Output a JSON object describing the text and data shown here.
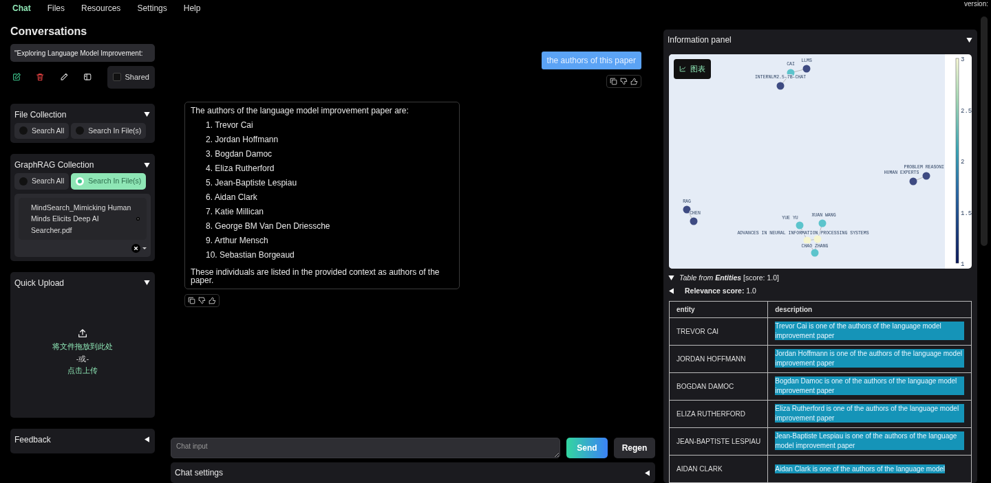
{
  "nav": {
    "tabs": [
      {
        "label": "Chat",
        "selected": true
      },
      {
        "label": "Files",
        "selected": false
      },
      {
        "label": "Resources",
        "selected": false
      },
      {
        "label": "Settings",
        "selected": false
      },
      {
        "label": "Help",
        "selected": false
      }
    ],
    "version": "version:"
  },
  "sidebar": {
    "title": "Conversations",
    "conversation": {
      "value": "\"Exploring Language Model Improvement:"
    },
    "shared": {
      "label": "Shared",
      "checked": false
    },
    "panels": [
      {
        "kind": "radio",
        "title": "File Collection",
        "expanded": true,
        "options": [
          {
            "label": "Search All",
            "selected": false
          },
          {
            "label": "Search In File(s)",
            "selected": false
          }
        ]
      },
      {
        "kind": "radio",
        "title": "GraphRAG Collection",
        "expanded": true,
        "options": [
          {
            "label": "Search All",
            "selected": false
          },
          {
            "label": "Search In File(s)",
            "selected": true
          }
        ],
        "files": [
          {
            "name": "MindSearch_Mimicking Human Minds Elicits Deep AI Searcher.pdf"
          }
        ]
      },
      {
        "kind": "upload",
        "title": "Quick Upload",
        "expanded": true,
        "lines": [
          "将文件拖放到此处",
          "-或-",
          "点击上传"
        ]
      },
      {
        "kind": "collapsed",
        "title": "Feedback",
        "expanded": false
      }
    ]
  },
  "chat": {
    "messages": [
      {
        "kind": "user",
        "text": "the authors of this paper"
      },
      {
        "kind": "assistant",
        "intro": "The authors of the language model improvement paper are:",
        "items": [
          "1. Trevor Cai",
          "2. Jordan Hoffmann",
          "3. Bogdan Damoc",
          "4. Eliza Rutherford",
          "5. Jean-Baptiste Lespiau",
          "6. Aidan Clark",
          "7. Katie Millican",
          "8. George BM Van Den Driessche",
          "9. Arthur Mensch",
          "10. Sebastian Borgeaud"
        ],
        "outro": "These individuals are listed in the provided context as authors of the paper."
      }
    ],
    "input": {
      "placeholder": "Chat input"
    },
    "buttons": [
      {
        "kind": "primary",
        "label": "Send"
      },
      {
        "kind": "secondary",
        "label": "Regen"
      }
    ],
    "settings": {
      "title": "Chat settings",
      "expanded": false
    }
  },
  "info_panel": {
    "title": "Information panel",
    "expanded": true,
    "graph": {
      "toolbar_label": "图表",
      "colorbar_ticks": [
        "3",
        "2.5",
        "2",
        "1.5",
        "1"
      ],
      "nodes": [
        {
          "label": "CAI",
          "color": "#5cc4cc"
        },
        {
          "label": "LLMS",
          "color": "#3e4b82"
        },
        {
          "label": "INTERNLM2.5-7B-CHAT",
          "color": "#3e4b82"
        },
        {
          "label": "PROBLEM REASONI",
          "color": "#3e4b82"
        },
        {
          "label": "HUMAN EXPERTS",
          "color": "#3e4b82"
        },
        {
          "label": "RAG",
          "color": "#3e4b82"
        },
        {
          "label": "CHEN",
          "color": "#3e4b82"
        },
        {
          "label": "YUE YU",
          "color": "#5cc4cc"
        },
        {
          "label": "XUAN WANG",
          "color": "#5cc4cc"
        },
        {
          "label": "ADVANCES IN NEURAL INFORMATION PROCESSING SYSTEMS",
          "color": "#f6f6cf"
        },
        {
          "color": "#f6f6cf"
        },
        {
          "label": "CHAO ZHANG",
          "color": "#5cc4cc"
        }
      ]
    },
    "caption": {
      "italic": "Table from",
      "bold_italic": "Entities",
      "rest": "[score: 1.0]",
      "expanded": true
    },
    "relevance": {
      "label": "Relevance score:",
      "value": "1.0",
      "expanded": false
    },
    "table": {
      "columns": [
        "entity",
        "description"
      ],
      "rows": [
        [
          "TREVOR CAI",
          "Trevor Cai is one of the authors of the language model improvement paper"
        ],
        [
          "JORDAN HOFFMANN",
          "Jordan Hoffmann is one of the authors of the language model improvement paper"
        ],
        [
          "BOGDAN DAMOC",
          "Bogdan Damoc is one of the authors of the language model improvement paper"
        ],
        [
          "ELIZA RUTHERFORD",
          "Eliza Rutherford is one of the authors of the language model improvement paper"
        ],
        [
          "JEAN-BAPTISTE LESPIAU",
          "Jean-Baptiste Lespiau is one of the authors of the language model improvement paper"
        ],
        [
          "AIDAN CLARK",
          "Aidan Clark is one of the authors of the language model"
        ]
      ]
    }
  }
}
